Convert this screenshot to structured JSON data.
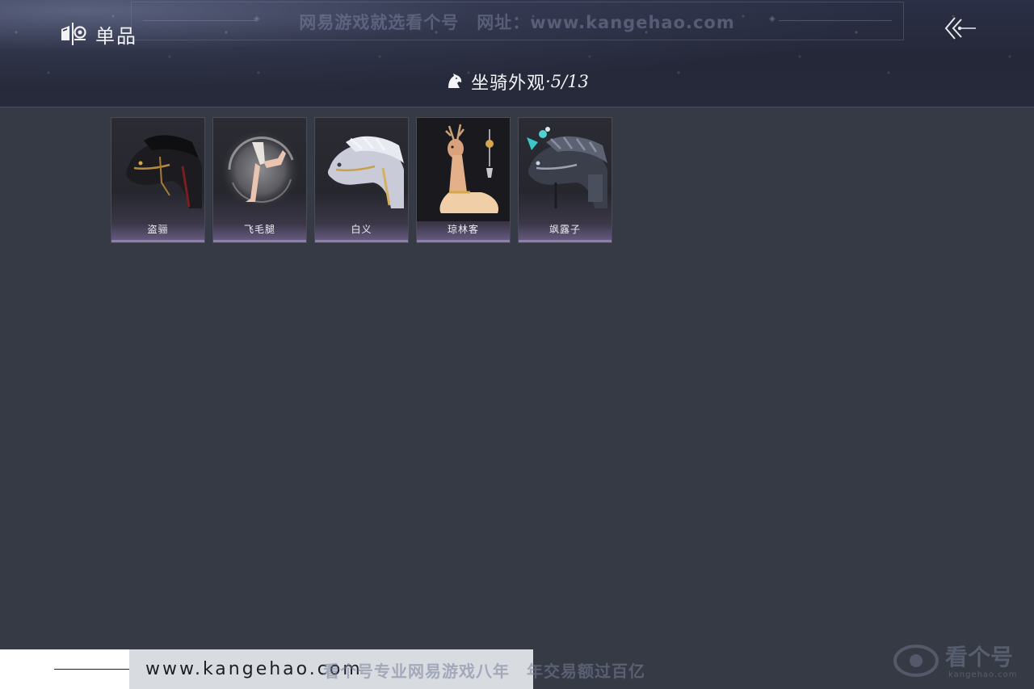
{
  "header": {
    "brand_label": "单品",
    "watermark_text": "网易游戏就选看个号　网址：www.kangehao.com",
    "section_title": "坐骑外观",
    "section_count": "·5/13"
  },
  "mounts": [
    {
      "name": "盗骊"
    },
    {
      "name": "飞毛腿"
    },
    {
      "name": "白义"
    },
    {
      "name": "琼林客"
    },
    {
      "name": "飒露子"
    }
  ],
  "footer": {
    "url": "www.kangehao.com",
    "slogan": "看个号专业网易游戏八年　年交易额过百亿",
    "logo_text": "看个号",
    "logo_sub": "kangehao.com"
  },
  "colors": {
    "background": "#353a44",
    "card_accent": "#8c7fae"
  }
}
